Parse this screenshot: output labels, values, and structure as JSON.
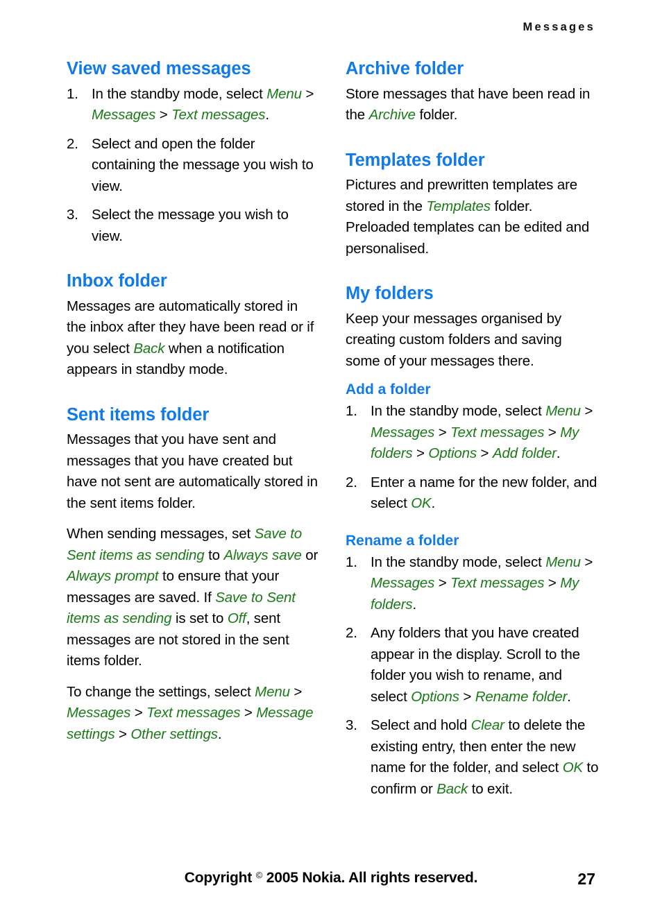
{
  "header": {
    "running_title": "Messages"
  },
  "footer": {
    "copyright_pre": "Copyright ",
    "copyright_symbol": "©",
    "copyright_post": " 2005 Nokia. All rights reserved.",
    "page_number": "27"
  },
  "colors": {
    "heading_blue": "#0f7ae8",
    "ui_term_green": "#1a7a17",
    "body_black": "#000000",
    "page_background": "#ffffff"
  },
  "left_column": {
    "sections": [
      {
        "heading": "View saved messages",
        "steps": [
          {
            "parts": [
              {
                "t": "In the standby mode, select ",
                "s": "plain"
              },
              {
                "t": "Menu",
                "s": "ui"
              },
              {
                "t": " > ",
                "s": "sep"
              },
              {
                "t": "Messages",
                "s": "ui"
              },
              {
                "t": " > ",
                "s": "sep"
              },
              {
                "t": "Text messages",
                "s": "ui"
              },
              {
                "t": ".",
                "s": "plain"
              }
            ]
          },
          {
            "parts": [
              {
                "t": "Select and open the folder containing the message you wish to view.",
                "s": "plain"
              }
            ]
          },
          {
            "parts": [
              {
                "t": "Select the message you wish to view.",
                "s": "plain"
              }
            ]
          }
        ]
      },
      {
        "heading": "Inbox folder",
        "paragraphs": [
          {
            "parts": [
              {
                "t": "Messages are automatically stored in the inbox after they have been read or if you select ",
                "s": "plain"
              },
              {
                "t": "Back",
                "s": "ui"
              },
              {
                "t": " when a notification appears in standby mode.",
                "s": "plain"
              }
            ]
          }
        ]
      },
      {
        "heading": "Sent items folder",
        "paragraphs": [
          {
            "parts": [
              {
                "t": "Messages that you have sent and messages that you have created but have not sent are automatically stored in the sent items folder.",
                "s": "plain"
              }
            ]
          },
          {
            "parts": [
              {
                "t": "When sending messages, set ",
                "s": "plain"
              },
              {
                "t": "Save to Sent items as sending",
                "s": "ui"
              },
              {
                "t": " to ",
                "s": "plain"
              },
              {
                "t": "Always save",
                "s": "ui"
              },
              {
                "t": " or ",
                "s": "plain"
              },
              {
                "t": "Always prompt",
                "s": "ui"
              },
              {
                "t": " to ensure that your messages are saved. If ",
                "s": "plain"
              },
              {
                "t": "Save to Sent items as sending",
                "s": "ui"
              },
              {
                "t": " is set to ",
                "s": "plain"
              },
              {
                "t": "Off",
                "s": "ui"
              },
              {
                "t": ", sent messages are not stored in the sent items folder.",
                "s": "plain"
              }
            ]
          },
          {
            "parts": [
              {
                "t": "To change the settings, select ",
                "s": "plain"
              },
              {
                "t": "Menu",
                "s": "ui"
              },
              {
                "t": " > ",
                "s": "sep"
              },
              {
                "t": "Messages",
                "s": "ui"
              },
              {
                "t": " > ",
                "s": "sep"
              },
              {
                "t": "Text messages",
                "s": "ui"
              },
              {
                "t": " > ",
                "s": "sep"
              },
              {
                "t": "Message settings",
                "s": "ui"
              },
              {
                "t": " > ",
                "s": "sep"
              },
              {
                "t": "Other settings",
                "s": "ui"
              },
              {
                "t": ".",
                "s": "plain"
              }
            ]
          }
        ]
      }
    ]
  },
  "right_column": {
    "sections": [
      {
        "heading": "Archive folder",
        "paragraphs": [
          {
            "parts": [
              {
                "t": "Store messages that have been read in the ",
                "s": "plain"
              },
              {
                "t": "Archive",
                "s": "ui"
              },
              {
                "t": " folder.",
                "s": "plain"
              }
            ]
          }
        ]
      },
      {
        "heading": "Templates folder",
        "paragraphs": [
          {
            "parts": [
              {
                "t": "Pictures and prewritten templates are stored in the ",
                "s": "plain"
              },
              {
                "t": "Templates",
                "s": "ui"
              },
              {
                "t": " folder. Preloaded templates can be edited and personalised.",
                "s": "plain"
              }
            ]
          }
        ]
      },
      {
        "heading": "My folders",
        "paragraphs": [
          {
            "parts": [
              {
                "t": "Keep your messages organised by creating custom folders and saving some of your messages there.",
                "s": "plain"
              }
            ]
          }
        ],
        "subsections": [
          {
            "heading": "Add a folder",
            "steps": [
              {
                "parts": [
                  {
                    "t": "In the standby mode, select ",
                    "s": "plain"
                  },
                  {
                    "t": "Menu",
                    "s": "ui"
                  },
                  {
                    "t": " > ",
                    "s": "sep"
                  },
                  {
                    "t": "Messages",
                    "s": "ui"
                  },
                  {
                    "t": " > ",
                    "s": "sep"
                  },
                  {
                    "t": "Text messages",
                    "s": "ui"
                  },
                  {
                    "t": " > ",
                    "s": "sep"
                  },
                  {
                    "t": "My folders",
                    "s": "ui"
                  },
                  {
                    "t": " > ",
                    "s": "sep"
                  },
                  {
                    "t": "Options",
                    "s": "ui"
                  },
                  {
                    "t": " > ",
                    "s": "sep"
                  },
                  {
                    "t": "Add folder",
                    "s": "ui"
                  },
                  {
                    "t": ".",
                    "s": "plain"
                  }
                ]
              },
              {
                "parts": [
                  {
                    "t": "Enter a name for the new folder, and select ",
                    "s": "plain"
                  },
                  {
                    "t": "OK",
                    "s": "ui"
                  },
                  {
                    "t": ".",
                    "s": "plain"
                  }
                ]
              }
            ]
          },
          {
            "heading": "Rename a folder",
            "steps": [
              {
                "parts": [
                  {
                    "t": "In the standby mode, select ",
                    "s": "plain"
                  },
                  {
                    "t": "Menu",
                    "s": "ui"
                  },
                  {
                    "t": " > ",
                    "s": "sep"
                  },
                  {
                    "t": "Messages",
                    "s": "ui"
                  },
                  {
                    "t": " > ",
                    "s": "sep"
                  },
                  {
                    "t": "Text messages",
                    "s": "ui"
                  },
                  {
                    "t": " > ",
                    "s": "sep"
                  },
                  {
                    "t": "My folders",
                    "s": "ui"
                  },
                  {
                    "t": ".",
                    "s": "plain"
                  }
                ]
              },
              {
                "parts": [
                  {
                    "t": "Any folders that you have created appear in the display. Scroll to the folder you wish to rename, and select ",
                    "s": "plain"
                  },
                  {
                    "t": "Options",
                    "s": "ui"
                  },
                  {
                    "t": " > ",
                    "s": "sep"
                  },
                  {
                    "t": "Rename folder",
                    "s": "ui"
                  },
                  {
                    "t": ".",
                    "s": "plain"
                  }
                ]
              },
              {
                "parts": [
                  {
                    "t": "Select and hold ",
                    "s": "plain"
                  },
                  {
                    "t": "Clear",
                    "s": "ui"
                  },
                  {
                    "t": " to delete the existing entry, then enter the new name for the folder, and select ",
                    "s": "plain"
                  },
                  {
                    "t": "OK",
                    "s": "ui"
                  },
                  {
                    "t": " to confirm or ",
                    "s": "plain"
                  },
                  {
                    "t": "Back",
                    "s": "ui"
                  },
                  {
                    "t": " to exit.",
                    "s": "plain"
                  }
                ]
              }
            ]
          }
        ]
      }
    ]
  }
}
